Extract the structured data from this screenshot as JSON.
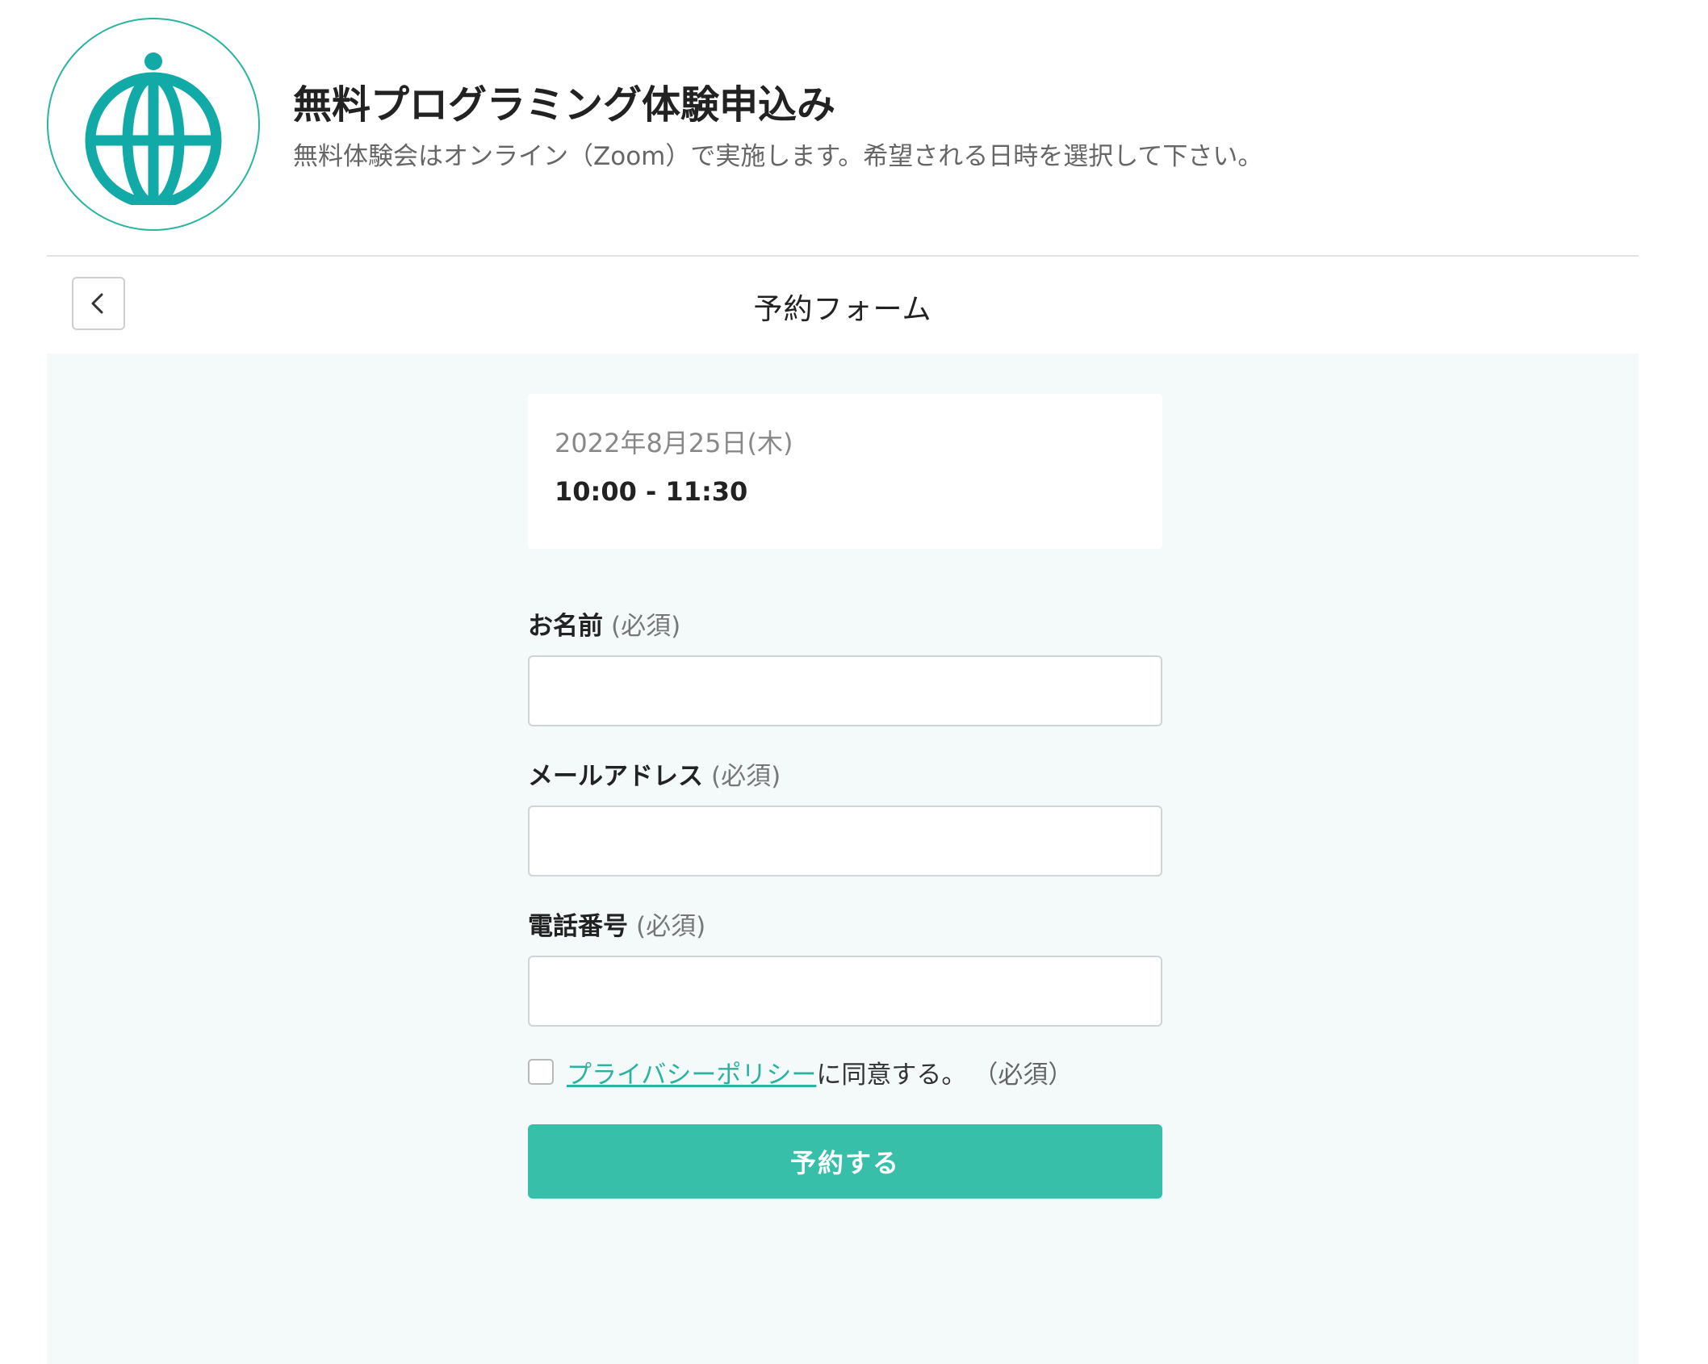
{
  "header": {
    "title": "無料プログラミング体験申込み",
    "subtitle": "無料体験会はオンライン（Zoom）で実施します。希望される日時を選択して下さい。"
  },
  "toolbar": {
    "heading": "予約フォーム"
  },
  "slot": {
    "date": "2022年8月25日(木)",
    "time": "10:00 - 11:30"
  },
  "form": {
    "name_label": "お名前",
    "email_label": "メールアドレス",
    "phone_label": "電話番号",
    "required_mark": "(必須)",
    "name_value": "",
    "email_value": "",
    "phone_value": ""
  },
  "consent": {
    "checked": false,
    "link_text": "プライバシーポリシー",
    "text": "に同意する。",
    "required": "（必須）"
  },
  "submit_label": "予約する",
  "colors": {
    "accent": "#37bfaa",
    "link": "#2bb3a0",
    "content_bg": "#f4f9f9"
  }
}
